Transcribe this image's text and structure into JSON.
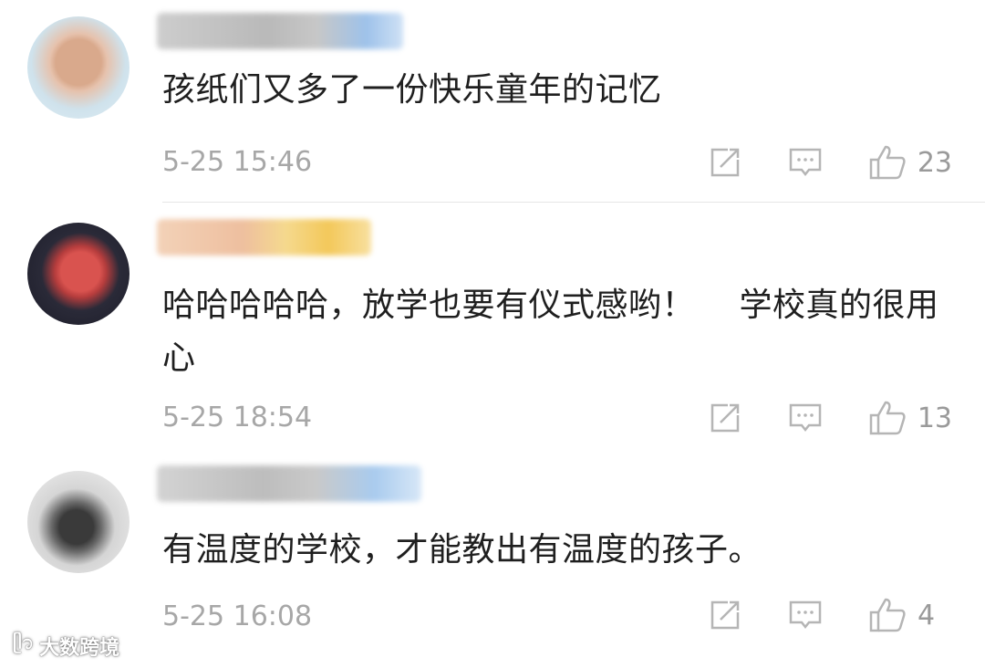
{
  "comments": [
    {
      "text": "孩纸们又多了一份快乐童年的记忆",
      "time": "5-25 15:46",
      "likes": "23",
      "avatar_colors": [
        "#cfe2ec",
        "#d9a98c"
      ],
      "username_colors": [
        "#bdbdbd",
        "#9ec2ea"
      ]
    },
    {
      "text": "哈哈哈哈哈，放学也要有仪式感哟！　 学校真的很用心",
      "time": "5-25 18:54",
      "likes": "13",
      "avatar_colors": [
        "#1c1c28",
        "#d9534f"
      ],
      "username_colors": [
        "#f0c9a8",
        "#f3c85a"
      ]
    },
    {
      "text": "有温度的学校，才能教出有温度的孩子。",
      "time": "5-25 16:08",
      "likes": "4",
      "avatar_colors": [
        "#f1f1f1",
        "#3a3a3a"
      ],
      "username_colors": [
        "#c8c8c8",
        "#a9cbee"
      ]
    }
  ],
  "icons": {
    "share": "share-icon",
    "comment": "comment-icon",
    "like": "thumbs-up-icon"
  },
  "watermark": {
    "text": "大数跨境"
  }
}
